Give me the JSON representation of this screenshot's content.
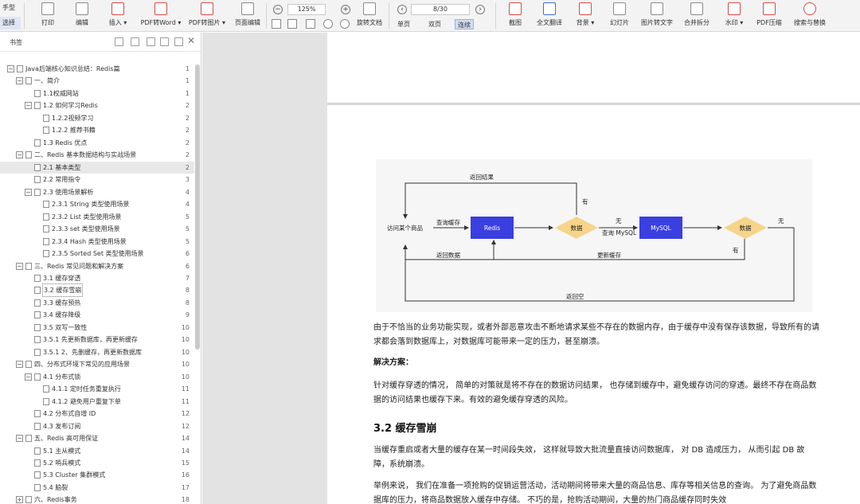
{
  "toolbar": {
    "modes": [
      "手型",
      "选择"
    ],
    "buttons": [
      {
        "label": "打印",
        "icon": "printer-icon"
      },
      {
        "label": "编辑",
        "icon": "edit-icon"
      },
      {
        "label": "插入 ▾",
        "icon": "insert-icon"
      },
      {
        "label": "PDF转Word ▾",
        "icon": "pdf-to-word-icon"
      },
      {
        "label": "PDF转图片 ▾",
        "icon": "pdf-to-image-icon"
      },
      {
        "label": "页面编辑",
        "icon": "page-edit-icon"
      },
      {
        "label": "旋转文档",
        "icon": "rotate-doc-icon"
      },
      {
        "label": "截图",
        "icon": "screenshot-icon"
      },
      {
        "label": "全文翻译",
        "icon": "translate-icon"
      },
      {
        "label": "背景 ▾",
        "icon": "background-icon"
      },
      {
        "label": "幻灯片",
        "icon": "slideshow-icon"
      },
      {
        "label": "图片转文字",
        "icon": "ocr-icon"
      },
      {
        "label": "合并拆分",
        "icon": "merge-split-icon"
      },
      {
        "label": "水印 ▾",
        "icon": "watermark-icon"
      },
      {
        "label": "PDF压缩",
        "icon": "pdf-compress-icon"
      },
      {
        "label": "搜索与替换",
        "icon": "search-replace-icon"
      }
    ],
    "zoom": "125%",
    "page_indicator": "8/30",
    "views": [
      "单页",
      "双页",
      "连续"
    ],
    "active_view": "连续"
  },
  "sidebar": {
    "title": "书签",
    "items": [
      {
        "text": "Java后端核心知识总结：Redis篇",
        "page": "1",
        "level": 0,
        "exp": "−"
      },
      {
        "text": "一、简介",
        "page": "1",
        "level": 1,
        "exp": "−"
      },
      {
        "text": "1.1权威网站",
        "page": "1",
        "level": 2,
        "exp": ""
      },
      {
        "text": "1.2 如何学习Redis",
        "page": "2",
        "level": 2,
        "exp": "−"
      },
      {
        "text": "1.2.2视频学习",
        "page": "2",
        "level": 3,
        "exp": ""
      },
      {
        "text": "1.2.2 推荐书籍",
        "page": "2",
        "level": 3,
        "exp": ""
      },
      {
        "text": "1.3  Redis 优点",
        "page": "2",
        "level": 2,
        "exp": ""
      },
      {
        "text": "二、Redis 基本数据结构与实战场景",
        "page": "2",
        "level": 1,
        "exp": "−"
      },
      {
        "text": "2.1 基本类型",
        "page": "2",
        "level": 2,
        "exp": "",
        "selected": true
      },
      {
        "text": "2.2 常用指令",
        "page": "3",
        "level": 2,
        "exp": ""
      },
      {
        "text": "2.3 使用场景解析",
        "page": "4",
        "level": 2,
        "exp": "−"
      },
      {
        "text": "2.3.1 String 类型使用场景",
        "page": "4",
        "level": 3,
        "exp": ""
      },
      {
        "text": "2.3.2 List 类型使用场景",
        "page": "5",
        "level": 3,
        "exp": ""
      },
      {
        "text": "2.3.3 set 类型使用场景",
        "page": "5",
        "level": 3,
        "exp": ""
      },
      {
        "text": "2.3.4 Hash 类型使用场景",
        "page": "5",
        "level": 3,
        "exp": ""
      },
      {
        "text": "2.3.5 Sorted Set 类型使用场景",
        "page": "6",
        "level": 3,
        "exp": ""
      },
      {
        "text": "三、Redis 常见问题和解决方案",
        "page": "6",
        "level": 1,
        "exp": "−"
      },
      {
        "text": "3.1 缓存穿透",
        "page": "7",
        "level": 2,
        "exp": ""
      },
      {
        "text": "3.2 缓存雪崩",
        "page": "8",
        "level": 2,
        "exp": "",
        "outlined": true
      },
      {
        "text": "3.3 缓存预热",
        "page": "8",
        "level": 2,
        "exp": ""
      },
      {
        "text": "3.4 缓存降级",
        "page": "9",
        "level": 2,
        "exp": ""
      },
      {
        "text": "3.5 双写一致性",
        "page": "10",
        "level": 2,
        "exp": ""
      },
      {
        "text": "3.5.1 先更新数据库，再更新缓存",
        "page": "10",
        "level": 2,
        "exp": ""
      },
      {
        "text": "3.5.1 2、先删缓存，再更新数据库",
        "page": "10",
        "level": 2,
        "exp": ""
      },
      {
        "text": "四、分布式环境下常见的应用场景",
        "page": "10",
        "level": 1,
        "exp": "−"
      },
      {
        "text": "4.1 分布式锁",
        "page": "10",
        "level": 2,
        "exp": "−"
      },
      {
        "text": "4.1.1 定时任务重复执行",
        "page": "11",
        "level": 3,
        "exp": ""
      },
      {
        "text": "4.1.2 避免用户重复下单",
        "page": "11",
        "level": 3,
        "exp": ""
      },
      {
        "text": "4.2 分布式自增 ID",
        "page": "12",
        "level": 2,
        "exp": ""
      },
      {
        "text": "4.3 发布订阅",
        "page": "12",
        "level": 2,
        "exp": ""
      },
      {
        "text": "五、Redis 高可用保证",
        "page": "14",
        "level": 1,
        "exp": "−"
      },
      {
        "text": "5.1 主从模式",
        "page": "14",
        "level": 2,
        "exp": ""
      },
      {
        "text": "5.2 哨兵模式",
        "page": "15",
        "level": 2,
        "exp": ""
      },
      {
        "text": "5.3 Cluster 集群模式",
        "page": "16",
        "level": 2,
        "exp": ""
      },
      {
        "text": "5.4 脑裂",
        "page": "17",
        "level": 2,
        "exp": ""
      },
      {
        "text": "六、Redis事务",
        "page": "18",
        "level": 1,
        "exp": "+"
      }
    ]
  },
  "diagram": {
    "start": "访问某个商品",
    "query_cache": "查询缓存",
    "redis": "Redis",
    "decision1": "数据",
    "has": "有",
    "none": "无",
    "query_mysql": "查询 MySQL",
    "mysql": "MySQL",
    "decision2": "数据",
    "none2": "无",
    "has2": "有",
    "return_result": "返回结果",
    "return_data": "返回数据",
    "update_cache": "更新缓存",
    "return_empty": "返回空",
    "colors": {
      "node": "#3a3fe0",
      "decision": "#f6d58a",
      "bg": "#f6f6f6"
    }
  },
  "doc": {
    "para1": "由于不恰当的业务功能实现，或者外部恶意攻击不断地请求某些不存在的数据内存，由于缓存中没有保存该数据，导致所有的请求都会落到数据库上，对数据库可能带来一定的压力，甚至崩溃。",
    "solution_title": "解决方案：",
    "para2": "针对缓存穿透的情况， 简单的对策就是将不存在的数据访问结果， 也存储到缓存中，避免缓存访问的穿透。最终不存在商品数据的访问结果也缓存下来。有效的避免缓存穿透的风险。",
    "section_title": "3.2 缓存雪崩",
    "para3": "当缓存重启或者大量的缓存在某一时间段失效， 这样就导致大批流量直接访问数据库， 对 DB 造成压力， 从而引起 DB 故障，系统崩溃。",
    "para4": "举例来说， 我们在准备一项抢购的促销运营活动，活动期间将带来大量的商品信息、库存等相关信息的查询。 为了避免商品数据库的压力，将商品数据放入缓存中存储。 不巧的是，抢购活动期间，大量的热门商品缓存同时失效"
  }
}
